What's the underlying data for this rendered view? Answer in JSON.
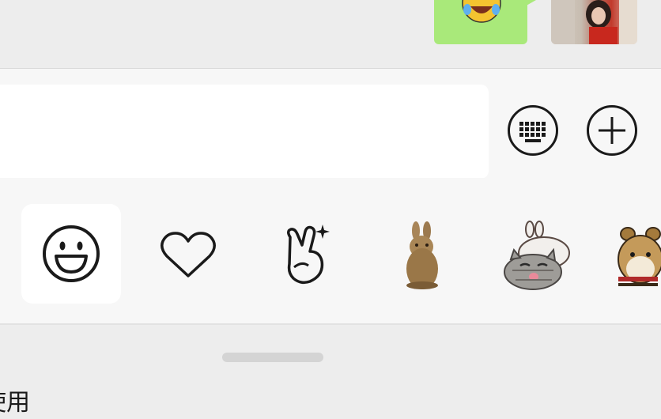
{
  "chat": {
    "sent_bubble_icon": "laughing-crying-emoji",
    "photo_thumbnail_icon": "photo-thumbnail"
  },
  "input_bar": {
    "text_value": "",
    "keyboard_icon": "keyboard-icon",
    "plus_icon": "plus-circle-icon"
  },
  "sticker_tabs": [
    {
      "icon": "smiley-face-icon",
      "selected": true
    },
    {
      "icon": "heart-outline-icon",
      "selected": false
    },
    {
      "icon": "victory-hand-sparkle-icon",
      "selected": false
    },
    {
      "icon": "bunny-sticker",
      "selected": false
    },
    {
      "icon": "cat-and-bunny-sticker",
      "selected": false
    },
    {
      "icon": "hamster-sticker",
      "selected": false
    }
  ],
  "bottom": {
    "label": "使用"
  },
  "colors": {
    "background": "#ededed",
    "tray": "#f7f7f7",
    "sent_bubble": "#a9e97a",
    "icon_stroke": "#1a1a1a"
  }
}
